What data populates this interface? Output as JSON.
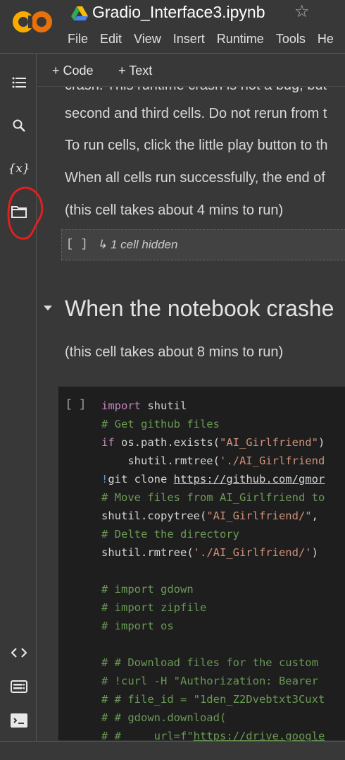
{
  "header": {
    "title": "Gradio_Interface3.ipynb",
    "logo_text": "CO",
    "menu": [
      "File",
      "Edit",
      "View",
      "Insert",
      "Runtime",
      "Tools",
      "He"
    ]
  },
  "toolbar": {
    "code_label": "+ Code",
    "text_label": "+ Text"
  },
  "sidebar": {
    "icons": [
      "table-of-contents-icon",
      "search-icon",
      "variables-icon",
      "folder-icon",
      "code-snippets-icon",
      "command-palette-icon",
      "terminal-icon"
    ],
    "variables_glyph": "{x}",
    "highlight_color": "#e02020"
  },
  "content": {
    "para0": "crash. This runtime crash is not a bug, but",
    "para1": "second and third cells. Do not rerun from t",
    "para2": "To run cells, click the little play button to th",
    "para3": "When all cells run successfully, the end of",
    "para4": "(this cell takes about 4 mins to run)",
    "hidden_cell": {
      "brackets": "[ ]",
      "label": "↳ 1 cell hidden"
    },
    "heading": "When the notebook crashe",
    "para5": "(this cell takes about 8 mins to run)",
    "code_cell": {
      "brackets": "[ ]",
      "lines": [
        [
          [
            "kw",
            "import"
          ],
          [
            "",
            "shutil"
          ]
        ],
        [
          [
            "cm",
            "# Get github files"
          ]
        ],
        [
          [
            "kw",
            "if"
          ],
          [
            "",
            " os.path.exists("
          ],
          [
            "st",
            "\"AI_Girlfriend\""
          ],
          [
            "",
            ")"
          ]
        ],
        [
          [
            "",
            "    shutil.rmtree("
          ],
          [
            "st",
            "'./AI_Girlfriend"
          ]
        ],
        [
          [
            "bang",
            "!"
          ],
          [
            "",
            "git clone "
          ],
          [
            "url",
            "https://github.com/gmor"
          ]
        ],
        [
          [
            "cm",
            "# Move files from AI_Girlfriend to"
          ]
        ],
        [
          [
            "",
            "shutil.copytree("
          ],
          [
            "st",
            "\"AI_Girlfriend/\""
          ],
          [
            "",
            ","
          ]
        ],
        [
          [
            "cm",
            "# Delte the directory"
          ]
        ],
        [
          [
            "",
            "shutil.rmtree("
          ],
          [
            "st",
            "'./AI_Girlfriend/'"
          ],
          [
            "",
            ")"
          ]
        ],
        [],
        [
          [
            "cm",
            "# import gdown"
          ]
        ],
        [
          [
            "cm",
            "# import zipfile"
          ]
        ],
        [
          [
            "cm",
            "# import os"
          ]
        ],
        [],
        [
          [
            "cm",
            "# # Download files for the custom"
          ]
        ],
        [
          [
            "cm",
            "# !curl -H \"Authorization: Bearer"
          ]
        ],
        [
          [
            "cm",
            "# # file_id = \"1den_Z2Dvebtxt3Cuxt"
          ]
        ],
        [
          [
            "cm",
            "# # gdown.download("
          ]
        ],
        [
          [
            "cm",
            "# #     url=f\""
          ],
          [
            "cm url",
            "https://drive.google"
          ]
        ]
      ]
    }
  }
}
